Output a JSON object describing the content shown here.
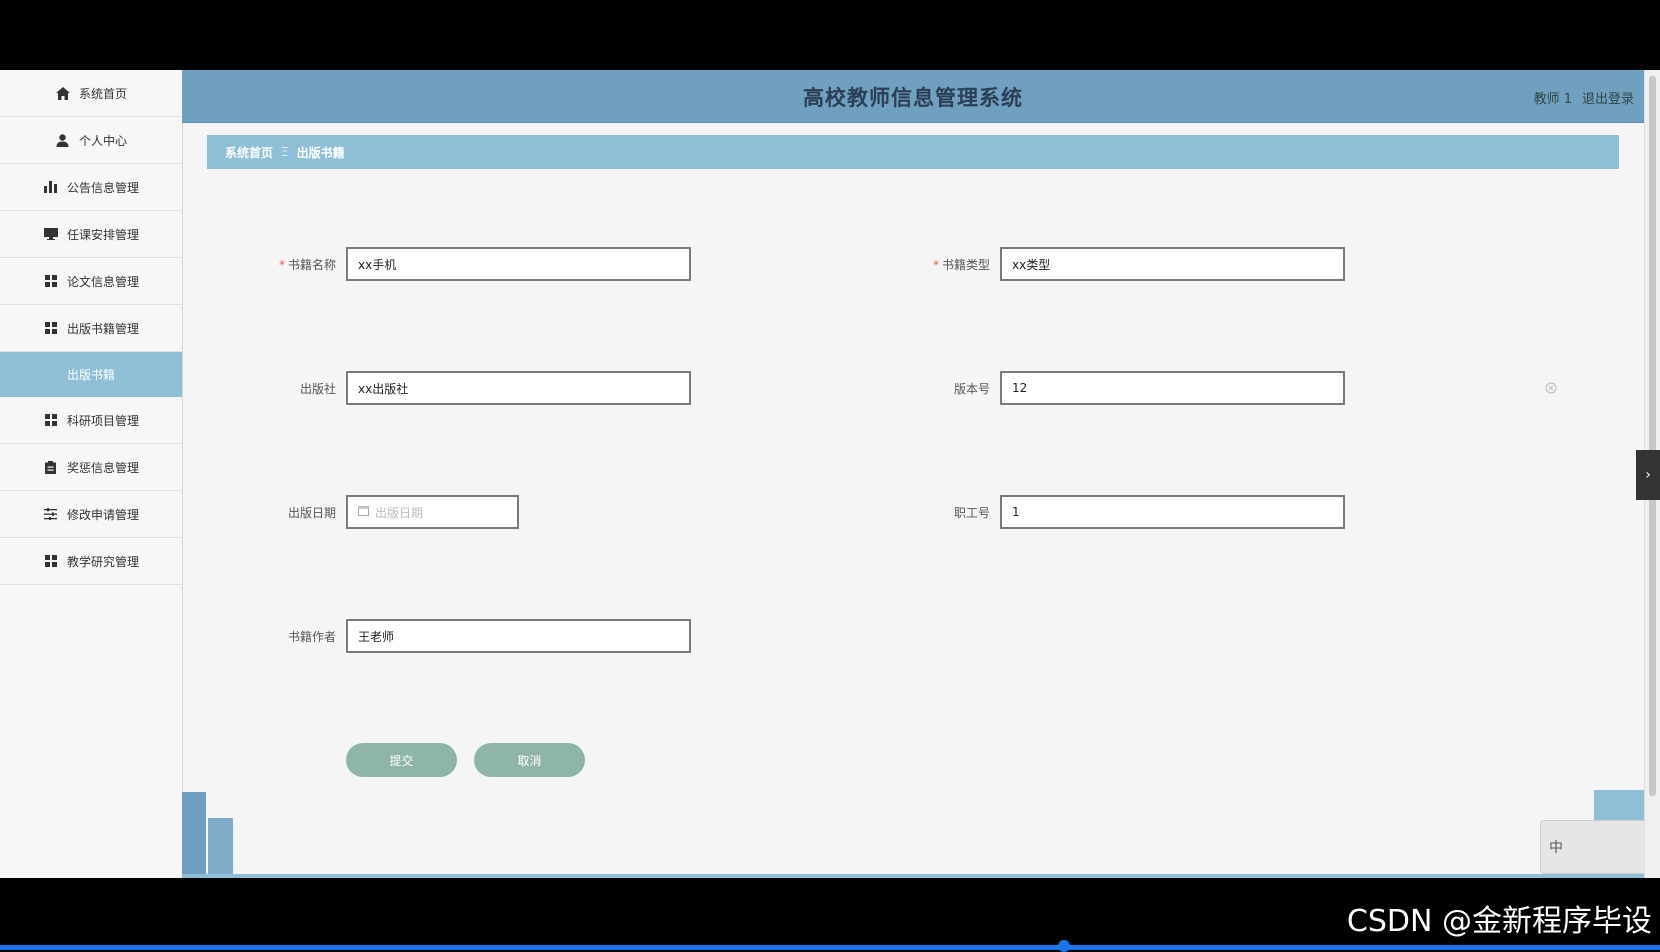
{
  "header": {
    "title": "高校教师信息管理系统",
    "user_name": "教师 1",
    "logout_label": "退出登录"
  },
  "sidebar": {
    "items": [
      {
        "label": "系统首页",
        "icon": "home-icon"
      },
      {
        "label": "个人中心",
        "icon": "user-icon"
      },
      {
        "label": "公告信息管理",
        "icon": "bar-chart-icon"
      },
      {
        "label": "任课安排管理",
        "icon": "monitor-icon"
      },
      {
        "label": "论文信息管理",
        "icon": "grid-icon"
      },
      {
        "label": "出版书籍管理",
        "icon": "grid-icon"
      },
      {
        "label": "出版书籍",
        "icon": ""
      },
      {
        "label": "科研项目管理",
        "icon": "grid-icon"
      },
      {
        "label": "奖惩信息管理",
        "icon": "clipboard-icon"
      },
      {
        "label": "修改申请管理",
        "icon": "sliders-icon"
      },
      {
        "label": "教学研究管理",
        "icon": "grid-icon"
      }
    ]
  },
  "breadcrumb": {
    "home": "系统首页",
    "separator": "Ξ",
    "current": "出版书籍"
  },
  "form": {
    "book_name": {
      "label": "书籍名称",
      "value": "xx手机"
    },
    "book_type": {
      "label": "书籍类型",
      "value": "xx类型"
    },
    "publisher": {
      "label": "出版社",
      "value": "xx出版社"
    },
    "edition": {
      "label": "版本号",
      "value": "12"
    },
    "publish_date": {
      "label": "出版日期",
      "placeholder": "出版日期"
    },
    "employee_id": {
      "label": "职工号",
      "value": "1"
    },
    "author": {
      "label": "书籍作者",
      "value": "王老师"
    },
    "submit_label": "提交",
    "cancel_label": "取消"
  },
  "ime": {
    "label": "中"
  },
  "watermark": "CSDN @金新程序毕设",
  "colors": {
    "header_bg": "#6fa0c0",
    "breadcrumb_bg": "#8fbfd6",
    "button_bg": "#8fb5a9",
    "required_mark": "#e06060"
  }
}
